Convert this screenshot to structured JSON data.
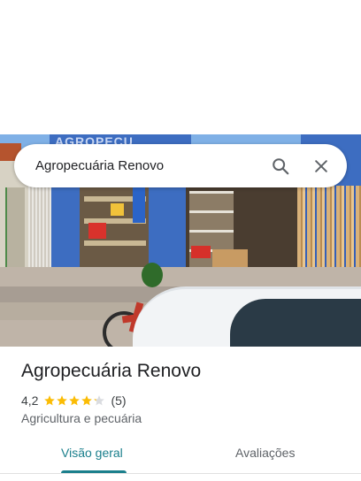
{
  "search": {
    "query": "Agropecuária Renovo",
    "search_icon": "search-icon",
    "close_icon": "close-icon"
  },
  "photo": {
    "sign_text": "AGROPECU"
  },
  "place": {
    "title": "Agropecuária Renovo",
    "rating": "4,2",
    "rating_value": 4.2,
    "stars_max": 5,
    "review_count": "(5)",
    "category": "Agricultura e pecuária"
  },
  "tabs": {
    "overview_label": "Visão geral",
    "reviews_label": "Avaliações",
    "active": "overview"
  },
  "colors": {
    "accent": "#1a7f8c",
    "star": "#fbbc04",
    "star_empty": "#dadce0"
  }
}
